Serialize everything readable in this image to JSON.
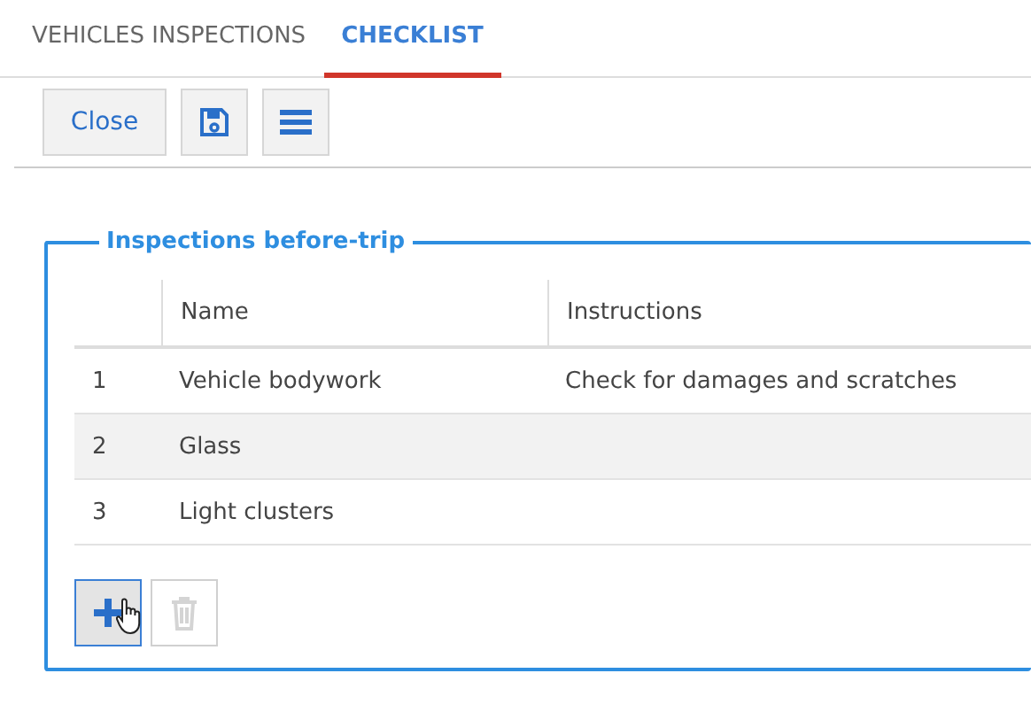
{
  "tabs": [
    {
      "label": "VEHICLES INSPECTIONS",
      "selected": false
    },
    {
      "label": "CHECKLIST",
      "selected": true
    }
  ],
  "toolbar": {
    "close_label": "Close"
  },
  "section": {
    "title": "Inspections before-trip",
    "columns": [
      "",
      "Name",
      "Instructions"
    ],
    "rows": [
      {
        "number": "1",
        "name": "Vehicle bodywork",
        "instructions": "Check for damages and scratches",
        "selected": false
      },
      {
        "number": "2",
        "name": "Glass",
        "instructions": "",
        "selected": true
      },
      {
        "number": "3",
        "name": "Light clusters",
        "instructions": "",
        "selected": false
      }
    ],
    "add_disabled": false,
    "delete_disabled": true
  }
}
